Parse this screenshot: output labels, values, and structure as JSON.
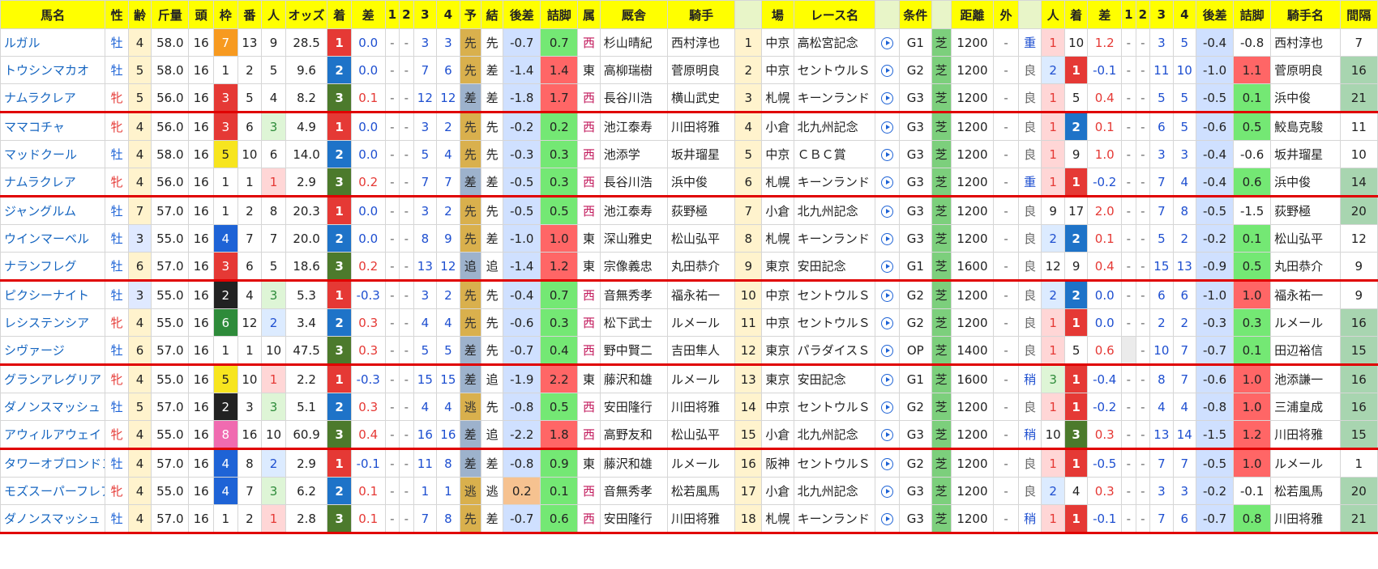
{
  "headers": {
    "left": [
      "馬名",
      "性",
      "齢",
      "斤量",
      "頭",
      "枠",
      "番",
      "人",
      "オッズ",
      "着",
      "差",
      "1",
      "2",
      "3",
      "4",
      "予",
      "結",
      "後差",
      "詰脚",
      "属",
      "厩舎",
      "騎手"
    ],
    "right": [
      "場",
      "レース名",
      "",
      "条件",
      "",
      "距離",
      "外",
      "",
      "人",
      "着",
      "差",
      "1",
      "2",
      "3",
      "4",
      "後差",
      "詰脚",
      "騎手名",
      "間隔"
    ]
  },
  "rows": [
    {
      "name": "ルガル",
      "sex": "牡",
      "age": "4",
      "kin": "58.0",
      "heads": "16",
      "waku": "7",
      "ban": "13",
      "pop": "9",
      "odds": "28.5",
      "pos": "1",
      "diff": "0.0",
      "c1": "-",
      "c2": "-",
      "c3": "3",
      "c4": "3",
      "pre": "先",
      "res": "先",
      "bd": "-0.7",
      "fin": "0.7",
      "zoku": "西",
      "stable": "杉山晴紀",
      "jockey": "西村淳也",
      "no": "1",
      "place": "中京",
      "race": "高松宮記念",
      "grade": "G1",
      "turf": "芝",
      "dist": "1200",
      "out": "-",
      "cond": "重",
      "rpop": "1",
      "rpos": "10",
      "rdiff": "1.2",
      "r1": "-",
      "r2": "-",
      "r3": "3",
      "r4": "5",
      "rbd": "-0.4",
      "rfin": "-0.8",
      "rjockey": "西村淳也",
      "interval": "7"
    },
    {
      "name": "トウシンマカオ",
      "sex": "牡",
      "age": "5",
      "kin": "58.0",
      "heads": "16",
      "waku": "1",
      "ban": "2",
      "pop": "5",
      "odds": "9.6",
      "pos": "2",
      "diff": "0.0",
      "c1": "-",
      "c2": "-",
      "c3": "7",
      "c4": "6",
      "pre": "先",
      "res": "差",
      "bd": "-1.4",
      "fin": "1.4",
      "zoku": "東",
      "stable": "高柳瑞樹",
      "jockey": "菅原明良",
      "no": "2",
      "place": "中京",
      "race": "セントウルＳ",
      "grade": "G2",
      "turf": "芝",
      "dist": "1200",
      "out": "-",
      "cond": "良",
      "rpop": "2",
      "rpos": "1",
      "rdiff": "-0.1",
      "r1": "-",
      "r2": "-",
      "r3": "11",
      "r4": "10",
      "rbd": "-1.0",
      "rfin": "1.1",
      "rjockey": "菅原明良",
      "interval": "16"
    },
    {
      "name": "ナムラクレア",
      "sex": "牝",
      "age": "5",
      "kin": "56.0",
      "heads": "16",
      "waku": "3",
      "ban": "5",
      "pop": "4",
      "odds": "8.2",
      "pos": "3",
      "diff": "0.1",
      "c1": "-",
      "c2": "-",
      "c3": "12",
      "c4": "12",
      "pre": "差",
      "res": "差",
      "bd": "-1.8",
      "fin": "1.7",
      "zoku": "西",
      "stable": "長谷川浩",
      "jockey": "横山武史",
      "no": "3",
      "place": "札幌",
      "race": "キーンランド",
      "grade": "G3",
      "turf": "芝",
      "dist": "1200",
      "out": "-",
      "cond": "良",
      "rpop": "1",
      "rpos": "5",
      "rdiff": "0.4",
      "r1": "-",
      "r2": "-",
      "r3": "5",
      "r4": "5",
      "rbd": "-0.5",
      "rfin": "0.1",
      "rjockey": "浜中俊",
      "interval": "21"
    },
    {
      "name": "ママコチャ",
      "sex": "牝",
      "age": "4",
      "kin": "56.0",
      "heads": "16",
      "waku": "3",
      "ban": "6",
      "pop": "3",
      "odds": "4.9",
      "pos": "1",
      "diff": "0.0",
      "c1": "-",
      "c2": "-",
      "c3": "3",
      "c4": "2",
      "pre": "先",
      "res": "先",
      "bd": "-0.2",
      "fin": "0.2",
      "zoku": "西",
      "stable": "池江泰寿",
      "jockey": "川田将雅",
      "no": "4",
      "place": "小倉",
      "race": "北九州記念",
      "grade": "G3",
      "turf": "芝",
      "dist": "1200",
      "out": "-",
      "cond": "良",
      "rpop": "1",
      "rpos": "2",
      "rdiff": "0.1",
      "r1": "-",
      "r2": "-",
      "r3": "6",
      "r4": "5",
      "rbd": "-0.6",
      "rfin": "0.5",
      "rjockey": "鮫島克駿",
      "interval": "11"
    },
    {
      "name": "マッドクール",
      "sex": "牡",
      "age": "4",
      "kin": "58.0",
      "heads": "16",
      "waku": "5",
      "ban": "10",
      "pop": "6",
      "odds": "14.0",
      "pos": "2",
      "diff": "0.0",
      "c1": "-",
      "c2": "-",
      "c3": "5",
      "c4": "4",
      "pre": "先",
      "res": "先",
      "bd": "-0.3",
      "fin": "0.3",
      "zoku": "西",
      "stable": "池添学",
      "jockey": "坂井瑠星",
      "no": "5",
      "place": "中京",
      "race": "ＣＢＣ賞",
      "grade": "G3",
      "turf": "芝",
      "dist": "1200",
      "out": "-",
      "cond": "良",
      "rpop": "1",
      "rpos": "9",
      "rdiff": "1.0",
      "r1": "-",
      "r2": "-",
      "r3": "3",
      "r4": "3",
      "rbd": "-0.4",
      "rfin": "-0.6",
      "rjockey": "坂井瑠星",
      "interval": "10"
    },
    {
      "name": "ナムラクレア",
      "sex": "牝",
      "age": "4",
      "kin": "56.0",
      "heads": "16",
      "waku": "1",
      "ban": "1",
      "pop": "1",
      "odds": "2.9",
      "pos": "3",
      "diff": "0.2",
      "c1": "-",
      "c2": "-",
      "c3": "7",
      "c4": "7",
      "pre": "差",
      "res": "差",
      "bd": "-0.5",
      "fin": "0.3",
      "zoku": "西",
      "stable": "長谷川浩",
      "jockey": "浜中俊",
      "no": "6",
      "place": "札幌",
      "race": "キーンランド",
      "grade": "G3",
      "turf": "芝",
      "dist": "1200",
      "out": "-",
      "cond": "重",
      "rpop": "1",
      "rpos": "1",
      "rdiff": "-0.2",
      "r1": "-",
      "r2": "-",
      "r3": "7",
      "r4": "4",
      "rbd": "-0.4",
      "rfin": "0.6",
      "rjockey": "浜中俊",
      "interval": "14"
    },
    {
      "name": "ジャングルム",
      "sex": "牡",
      "age": "7",
      "kin": "57.0",
      "heads": "16",
      "waku": "1",
      "ban": "2",
      "pop": "8",
      "odds": "20.3",
      "pos": "1",
      "diff": "0.0",
      "c1": "-",
      "c2": "-",
      "c3": "3",
      "c4": "2",
      "pre": "先",
      "res": "先",
      "bd": "-0.5",
      "fin": "0.5",
      "zoku": "西",
      "stable": "池江泰寿",
      "jockey": "荻野極",
      "no": "7",
      "place": "小倉",
      "race": "北九州記念",
      "grade": "G3",
      "turf": "芝",
      "dist": "1200",
      "out": "-",
      "cond": "良",
      "rpop": "9",
      "rpos": "17",
      "rdiff": "2.0",
      "r1": "-",
      "r2": "-",
      "r3": "7",
      "r4": "8",
      "rbd": "-0.5",
      "rfin": "-1.5",
      "rjockey": "荻野極",
      "interval": "20"
    },
    {
      "name": "ウインマーベル",
      "sex": "牡",
      "age": "3",
      "kin": "55.0",
      "heads": "16",
      "waku": "4",
      "ban": "7",
      "pop": "7",
      "odds": "20.0",
      "pos": "2",
      "diff": "0.0",
      "c1": "-",
      "c2": "-",
      "c3": "8",
      "c4": "9",
      "pre": "先",
      "res": "差",
      "bd": "-1.0",
      "fin": "1.0",
      "zoku": "東",
      "stable": "深山雅史",
      "jockey": "松山弘平",
      "no": "8",
      "place": "札幌",
      "race": "キーンランド",
      "grade": "G3",
      "turf": "芝",
      "dist": "1200",
      "out": "-",
      "cond": "良",
      "rpop": "2",
      "rpos": "2",
      "rdiff": "0.1",
      "r1": "-",
      "r2": "-",
      "r3": "5",
      "r4": "2",
      "rbd": "-0.2",
      "rfin": "0.1",
      "rjockey": "松山弘平",
      "interval": "12"
    },
    {
      "name": "ナランフレグ",
      "sex": "牡",
      "age": "6",
      "kin": "57.0",
      "heads": "16",
      "waku": "3",
      "ban": "6",
      "pop": "5",
      "odds": "18.6",
      "pos": "3",
      "diff": "0.2",
      "c1": "-",
      "c2": "-",
      "c3": "13",
      "c4": "12",
      "pre": "追",
      "res": "追",
      "bd": "-1.4",
      "fin": "1.2",
      "zoku": "東",
      "stable": "宗像義忠",
      "jockey": "丸田恭介",
      "no": "9",
      "place": "東京",
      "race": "安田記念",
      "grade": "G1",
      "turf": "芝",
      "dist": "1600",
      "out": "-",
      "cond": "良",
      "rpop": "12",
      "rpos": "9",
      "rdiff": "0.4",
      "r1": "-",
      "r2": "-",
      "r3": "15",
      "r4": "13",
      "rbd": "-0.9",
      "rfin": "0.5",
      "rjockey": "丸田恭介",
      "interval": "9"
    },
    {
      "name": "ピクシーナイト",
      "sex": "牡",
      "age": "3",
      "kin": "55.0",
      "heads": "16",
      "waku": "2",
      "ban": "4",
      "pop": "3",
      "odds": "5.3",
      "pos": "1",
      "diff": "-0.3",
      "c1": "-",
      "c2": "-",
      "c3": "3",
      "c4": "2",
      "pre": "先",
      "res": "先",
      "bd": "-0.4",
      "fin": "0.7",
      "zoku": "西",
      "stable": "音無秀孝",
      "jockey": "福永祐一",
      "no": "10",
      "place": "中京",
      "race": "セントウルＳ",
      "grade": "G2",
      "turf": "芝",
      "dist": "1200",
      "out": "-",
      "cond": "良",
      "rpop": "2",
      "rpos": "2",
      "rdiff": "0.0",
      "r1": "-",
      "r2": "-",
      "r3": "6",
      "r4": "6",
      "rbd": "-1.0",
      "rfin": "1.0",
      "rjockey": "福永祐一",
      "interval": "9"
    },
    {
      "name": "レシステンシア",
      "sex": "牝",
      "age": "4",
      "kin": "55.0",
      "heads": "16",
      "waku": "6",
      "ban": "12",
      "pop": "2",
      "odds": "3.4",
      "pos": "2",
      "diff": "0.3",
      "c1": "-",
      "c2": "-",
      "c3": "4",
      "c4": "4",
      "pre": "先",
      "res": "先",
      "bd": "-0.6",
      "fin": "0.3",
      "zoku": "西",
      "stable": "松下武士",
      "jockey": "ルメール",
      "no": "11",
      "place": "中京",
      "race": "セントウルＳ",
      "grade": "G2",
      "turf": "芝",
      "dist": "1200",
      "out": "-",
      "cond": "良",
      "rpop": "1",
      "rpos": "1",
      "rdiff": "0.0",
      "r1": "-",
      "r2": "-",
      "r3": "2",
      "r4": "2",
      "rbd": "-0.3",
      "rfin": "0.3",
      "rjockey": "ルメール",
      "interval": "16"
    },
    {
      "name": "シヴァージ",
      "sex": "牡",
      "age": "6",
      "kin": "57.0",
      "heads": "16",
      "waku": "1",
      "ban": "1",
      "pop": "10",
      "odds": "47.5",
      "pos": "3",
      "diff": "0.3",
      "c1": "-",
      "c2": "-",
      "c3": "5",
      "c4": "5",
      "pre": "差",
      "res": "先",
      "bd": "-0.7",
      "fin": "0.4",
      "zoku": "西",
      "stable": "野中賢二",
      "jockey": "吉田隼人",
      "no": "12",
      "place": "東京",
      "race": "パラダイスＳ",
      "grade": "OP",
      "turf": "芝",
      "dist": "1400",
      "out": "-",
      "cond": "良",
      "rpop": "1",
      "rpos": "5",
      "rdiff": "0.6",
      "r1": "",
      "r2": "-",
      "r3": "10",
      "r4": "7",
      "rbd": "-0.7",
      "rfin": "0.1",
      "rjockey": "田辺裕信",
      "interval": "15"
    },
    {
      "name": "グランアレグリア",
      "sex": "牝",
      "age": "4",
      "kin": "55.0",
      "heads": "16",
      "waku": "5",
      "ban": "10",
      "pop": "1",
      "odds": "2.2",
      "pos": "1",
      "diff": "-0.3",
      "c1": "-",
      "c2": "-",
      "c3": "15",
      "c4": "15",
      "pre": "差",
      "res": "追",
      "bd": "-1.9",
      "fin": "2.2",
      "zoku": "東",
      "stable": "藤沢和雄",
      "jockey": "ルメール",
      "no": "13",
      "place": "東京",
      "race": "安田記念",
      "grade": "G1",
      "turf": "芝",
      "dist": "1600",
      "out": "-",
      "cond": "稍",
      "rpop": "3",
      "rpos": "1",
      "rdiff": "-0.4",
      "r1": "-",
      "r2": "-",
      "r3": "8",
      "r4": "7",
      "rbd": "-0.6",
      "rfin": "1.0",
      "rjockey": "池添謙一",
      "interval": "16"
    },
    {
      "name": "ダノンスマッシュ",
      "sex": "牡",
      "age": "5",
      "kin": "57.0",
      "heads": "16",
      "waku": "2",
      "ban": "3",
      "pop": "3",
      "odds": "5.1",
      "pos": "2",
      "diff": "0.3",
      "c1": "-",
      "c2": "-",
      "c3": "4",
      "c4": "4",
      "pre": "逃",
      "res": "先",
      "bd": "-0.8",
      "fin": "0.5",
      "zoku": "西",
      "stable": "安田隆行",
      "jockey": "川田将雅",
      "no": "14",
      "place": "中京",
      "race": "セントウルＳ",
      "grade": "G2",
      "turf": "芝",
      "dist": "1200",
      "out": "-",
      "cond": "良",
      "rpop": "1",
      "rpos": "1",
      "rdiff": "-0.2",
      "r1": "-",
      "r2": "-",
      "r3": "4",
      "r4": "4",
      "rbd": "-0.8",
      "rfin": "1.0",
      "rjockey": "三浦皇成",
      "interval": "16"
    },
    {
      "name": "アウィルアウェイ",
      "sex": "牝",
      "age": "4",
      "kin": "55.0",
      "heads": "16",
      "waku": "8",
      "ban": "16",
      "pop": "10",
      "odds": "60.9",
      "pos": "3",
      "diff": "0.4",
      "c1": "-",
      "c2": "-",
      "c3": "16",
      "c4": "16",
      "pre": "差",
      "res": "追",
      "bd": "-2.2",
      "fin": "1.8",
      "zoku": "西",
      "stable": "高野友和",
      "jockey": "松山弘平",
      "no": "15",
      "place": "小倉",
      "race": "北九州記念",
      "grade": "G3",
      "turf": "芝",
      "dist": "1200",
      "out": "-",
      "cond": "稍",
      "rpop": "10",
      "rpos": "3",
      "rdiff": "0.3",
      "r1": "-",
      "r2": "-",
      "r3": "13",
      "r4": "14",
      "rbd": "-1.5",
      "rfin": "1.2",
      "rjockey": "川田将雅",
      "interval": "15"
    },
    {
      "name": "タワーオブロンドン",
      "sex": "牡",
      "age": "4",
      "kin": "57.0",
      "heads": "16",
      "waku": "4",
      "ban": "8",
      "pop": "2",
      "odds": "2.9",
      "pos": "1",
      "diff": "-0.1",
      "c1": "-",
      "c2": "-",
      "c3": "11",
      "c4": "8",
      "pre": "差",
      "res": "差",
      "bd": "-0.8",
      "fin": "0.9",
      "zoku": "東",
      "stable": "藤沢和雄",
      "jockey": "ルメール",
      "no": "16",
      "place": "阪神",
      "race": "セントウルＳ",
      "grade": "G2",
      "turf": "芝",
      "dist": "1200",
      "out": "-",
      "cond": "良",
      "rpop": "1",
      "rpos": "1",
      "rdiff": "-0.5",
      "r1": "-",
      "r2": "-",
      "r3": "7",
      "r4": "7",
      "rbd": "-0.5",
      "rfin": "1.0",
      "rjockey": "ルメール",
      "interval": "1"
    },
    {
      "name": "モズスーパーフレア",
      "sex": "牝",
      "age": "4",
      "kin": "55.0",
      "heads": "16",
      "waku": "4",
      "ban": "7",
      "pop": "3",
      "odds": "6.2",
      "pos": "2",
      "diff": "0.1",
      "c1": "-",
      "c2": "-",
      "c3": "1",
      "c4": "1",
      "pre": "逃",
      "res": "逃",
      "bd": "0.2",
      "fin": "0.1",
      "zoku": "西",
      "stable": "音無秀孝",
      "jockey": "松若風馬",
      "no": "17",
      "place": "小倉",
      "race": "北九州記念",
      "grade": "G3",
      "turf": "芝",
      "dist": "1200",
      "out": "-",
      "cond": "良",
      "rpop": "2",
      "rpos": "4",
      "rdiff": "0.3",
      "r1": "-",
      "r2": "-",
      "r3": "3",
      "r4": "3",
      "rbd": "-0.2",
      "rfin": "-0.1",
      "rjockey": "松若風馬",
      "interval": "20"
    },
    {
      "name": "ダノンスマッシュ",
      "sex": "牡",
      "age": "4",
      "kin": "57.0",
      "heads": "16",
      "waku": "1",
      "ban": "2",
      "pop": "1",
      "odds": "2.8",
      "pos": "3",
      "diff": "0.1",
      "c1": "-",
      "c2": "-",
      "c3": "7",
      "c4": "8",
      "pre": "先",
      "res": "差",
      "bd": "-0.7",
      "fin": "0.6",
      "zoku": "西",
      "stable": "安田隆行",
      "jockey": "川田将雅",
      "no": "18",
      "place": "札幌",
      "race": "キーンランド",
      "grade": "G3",
      "turf": "芝",
      "dist": "1200",
      "out": "-",
      "cond": "稍",
      "rpop": "1",
      "rpos": "1",
      "rdiff": "-0.1",
      "r1": "-",
      "r2": "-",
      "r3": "7",
      "r4": "6",
      "rbd": "-0.7",
      "rfin": "0.8",
      "rjockey": "川田将雅",
      "interval": "21"
    }
  ]
}
